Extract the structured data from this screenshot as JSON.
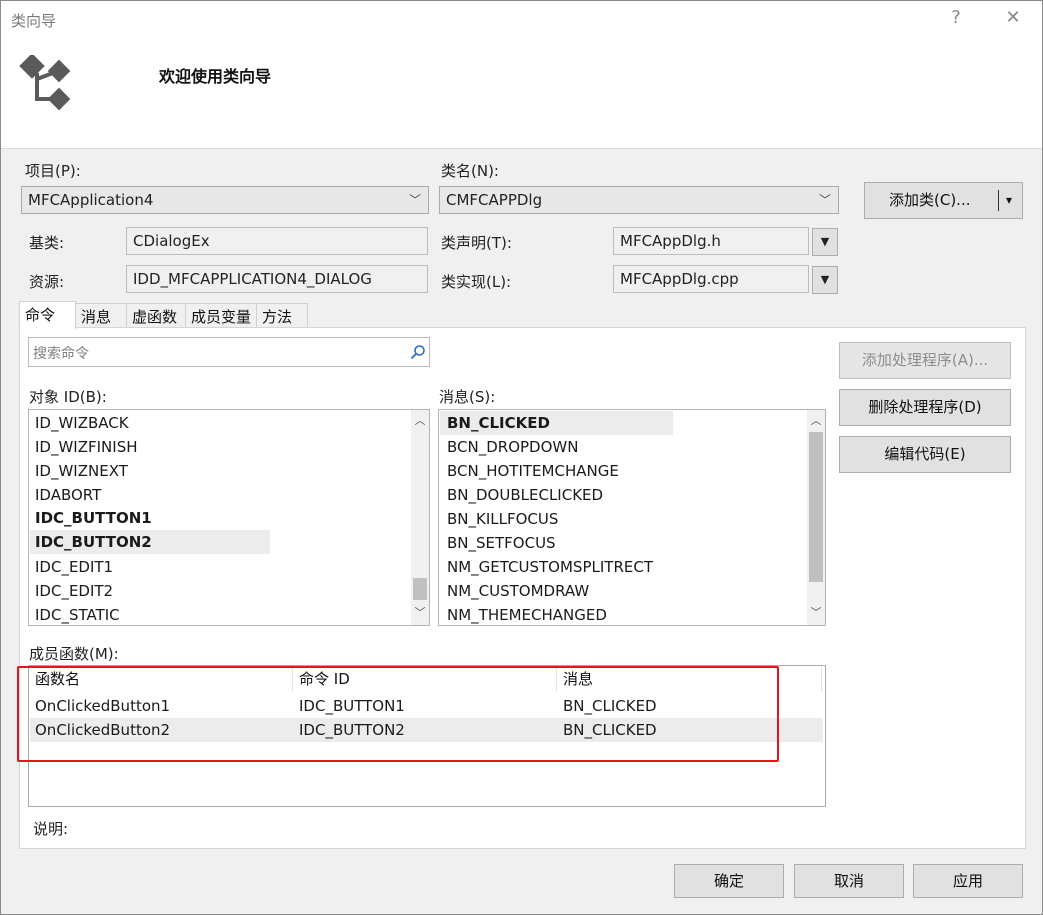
{
  "window": {
    "title": "类向导",
    "help_glyph": "?",
    "close_glyph": "✕"
  },
  "header": {
    "welcome": "欢迎使用类向导",
    "logo_icon": "class-wizard-icon"
  },
  "project": {
    "label": "项目(P):",
    "value": "MFCApplication4"
  },
  "class_name": {
    "label": "类名(N):",
    "value": "CMFCAPPDlg"
  },
  "add_class": {
    "label": "添加类(C)...",
    "split_glyph": "▾"
  },
  "base_class": {
    "label": "基类:",
    "value": "CDialogEx"
  },
  "resource": {
    "label": "资源:",
    "value": "IDD_MFCAPPLICATION4_DIALOG"
  },
  "class_decl": {
    "label": "类声明(T):",
    "value": "MFCAppDlg.h"
  },
  "class_impl": {
    "label": "类实现(L):",
    "value": "MFCAppDlg.cpp"
  },
  "tabs": [
    {
      "label": "命令",
      "active": true
    },
    {
      "label": "消息",
      "active": false
    },
    {
      "label": "虚函数",
      "active": false
    },
    {
      "label": "成员变量",
      "active": false
    },
    {
      "label": "方法",
      "active": false
    }
  ],
  "search": {
    "placeholder": "搜索命令",
    "icon": "search-icon"
  },
  "object_ids": {
    "label": "对象 ID(B):",
    "items": [
      {
        "text": "ID_WIZBACK",
        "bold": false
      },
      {
        "text": "ID_WIZFINISH",
        "bold": false
      },
      {
        "text": "ID_WIZNEXT",
        "bold": false
      },
      {
        "text": "IDABORT",
        "bold": false
      },
      {
        "text": "IDC_BUTTON1",
        "bold": true
      },
      {
        "text": "IDC_BUTTON2",
        "bold": true,
        "selected": true
      },
      {
        "text": "IDC_EDIT1",
        "bold": false
      },
      {
        "text": "IDC_EDIT2",
        "bold": false
      },
      {
        "text": "IDC_STATIC",
        "bold": false
      }
    ]
  },
  "messages": {
    "label": "消息(S):",
    "items": [
      {
        "text": "BN_CLICKED",
        "bold": true,
        "selected": true
      },
      {
        "text": "BCN_DROPDOWN",
        "bold": false
      },
      {
        "text": "BCN_HOTITEMCHANGE",
        "bold": false
      },
      {
        "text": "BN_DOUBLECLICKED",
        "bold": false
      },
      {
        "text": "BN_KILLFOCUS",
        "bold": false
      },
      {
        "text": "BN_SETFOCUS",
        "bold": false
      },
      {
        "text": "NM_GETCUSTOMSPLITRECT",
        "bold": false
      },
      {
        "text": "NM_CUSTOMDRAW",
        "bold": false
      },
      {
        "text": "NM_THEMECHANGED",
        "bold": false
      }
    ]
  },
  "actions": {
    "add_handler": "添加处理程序(A)...",
    "delete_handler": "删除处理程序(D)",
    "edit_code": "编辑代码(E)"
  },
  "member_functions": {
    "label": "成员函数(M):",
    "columns": [
      "函数名",
      "命令 ID",
      "消息"
    ],
    "rows": [
      [
        "OnClickedButton1",
        "IDC_BUTTON1",
        "BN_CLICKED"
      ],
      [
        "OnClickedButton2",
        "IDC_BUTTON2",
        "BN_CLICKED"
      ]
    ]
  },
  "description": {
    "label": "说明:"
  },
  "footer": {
    "ok": "确定",
    "cancel": "取消",
    "apply": "应用"
  },
  "colors": {
    "highlight_box": "#e8141c",
    "selection": "#ececec"
  }
}
